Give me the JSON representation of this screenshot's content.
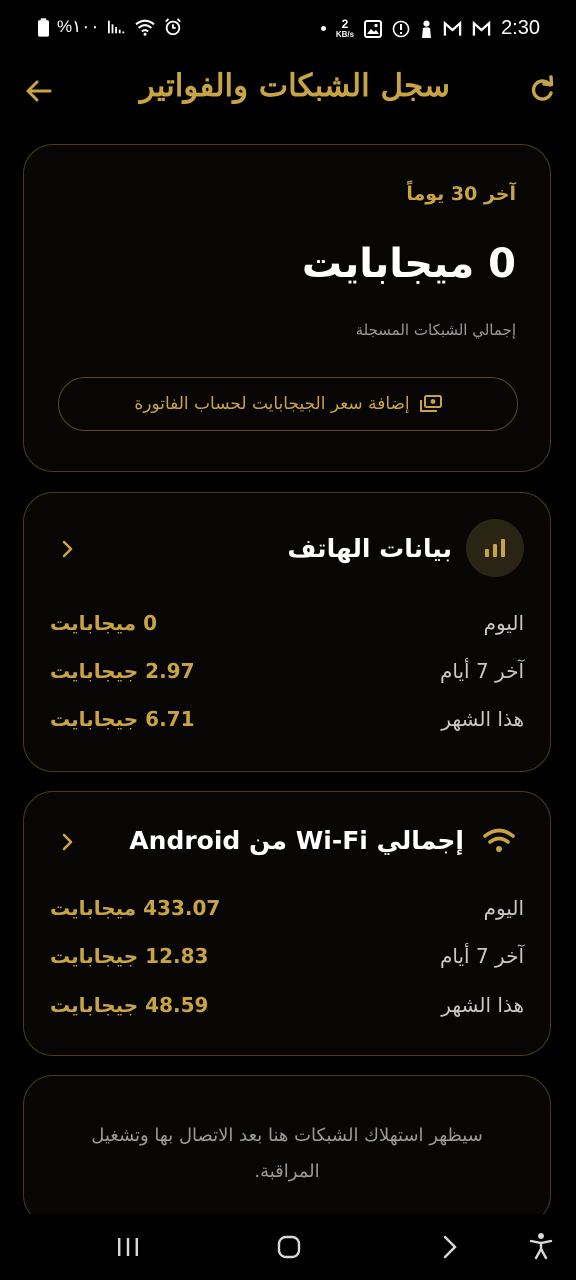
{
  "status_bar": {
    "battery": "%١٠٠",
    "speed_value": "2",
    "speed_unit": "KB/s",
    "time": "2:30"
  },
  "header": {
    "title": "سجل الشبكات والفواتير",
    "icons": [
      "back-arrow-icon",
      "refresh-icon"
    ]
  },
  "summary": {
    "period": "آخر 30 يوماً",
    "total": "0 ميجابايت",
    "subtitle": "إجمالي الشبكات المسجلة",
    "price_button": "إضافة سعر الجيجابايت لحساب الفاتورة"
  },
  "phone_data": {
    "title": "بيانات الهاتف",
    "rows": [
      {
        "label": "اليوم",
        "value": "0 ميجابايت"
      },
      {
        "label": "آخر 7 أيام",
        "value": "2.97 جيجابايت"
      },
      {
        "label": "هذا الشهر",
        "value": "6.71 جيجابايت"
      }
    ]
  },
  "wifi_data": {
    "title": "إجمالي Wi-Fi من Android",
    "rows": [
      {
        "label": "اليوم",
        "value": "433.07 ميجابايت"
      },
      {
        "label": "آخر 7 أيام",
        "value": "12.83 جيجابايت"
      },
      {
        "label": "هذا الشهر",
        "value": "48.59 جيجابايت"
      }
    ]
  },
  "note": {
    "text": "سيظهر استهلاك الشبكات هنا بعد الاتصال بها وتشغيل المراقبة."
  },
  "colors": {
    "background": "#000000",
    "accent": "#c9a445",
    "card_border": "#4a3c1c",
    "muted_text": "#9a9a9a"
  }
}
